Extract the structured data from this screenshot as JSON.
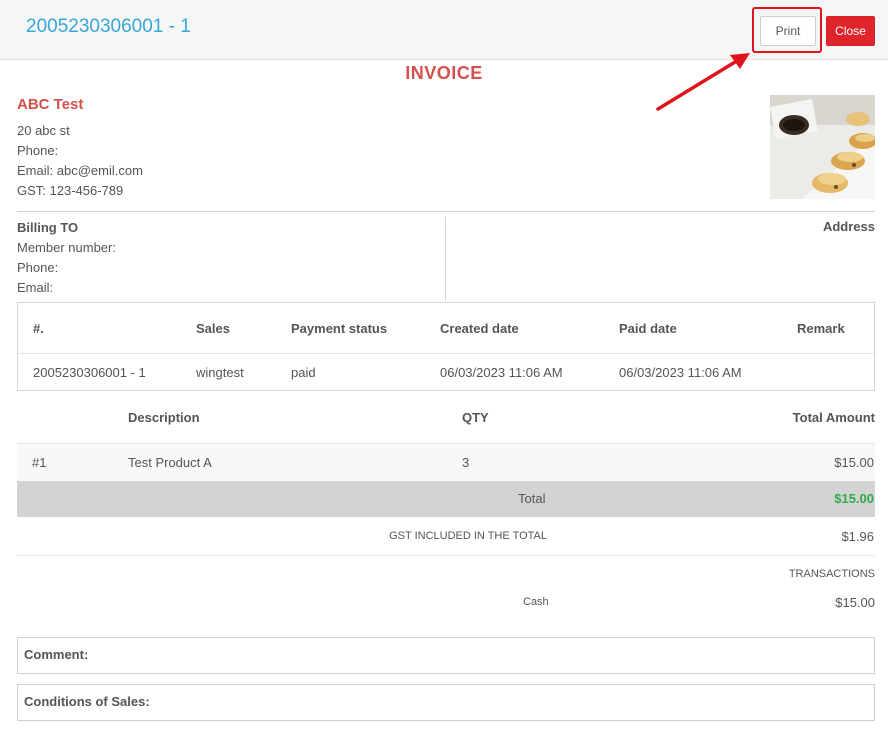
{
  "header": {
    "order_title": "2005230306001 - 1",
    "print_label": "Print",
    "close_label": "Close"
  },
  "invoice": {
    "title": "INVOICE",
    "company": {
      "name": "ABC Test",
      "address": "20 abc st",
      "phone": "Phone:",
      "email": "Email: abc@emil.com",
      "gst": "GST: 123-456-789"
    },
    "billing": {
      "heading": "Billing TO",
      "member_number": "Member number:",
      "phone": "Phone:",
      "email": "Email:",
      "address_heading": "Address"
    },
    "order_table": {
      "headers": [
        "#.",
        "Sales",
        "Payment status",
        "Created date",
        "Paid date",
        "Remark"
      ],
      "row": [
        "2005230306001 - 1",
        "wingtest",
        "paid",
        "06/03/2023 11:06 AM",
        "06/03/2023 11:06 AM",
        ""
      ]
    },
    "items_table": {
      "headers": [
        "Description",
        "QTY",
        "Total Amount"
      ],
      "rows": [
        {
          "index": "#1",
          "description": "Test Product A",
          "qty": "3",
          "amount": "$15.00"
        }
      ]
    },
    "totals": {
      "total_label": "Total",
      "total_value": "$15.00",
      "gst_label": "GST INCLUDED IN THE TOTAL",
      "gst_value": "$1.96",
      "transactions_label": "TRANSACTIONS",
      "cash_label": "Cash",
      "cash_value": "$15.00"
    },
    "comment_label": "Comment:",
    "conditions_label": "Conditions of Sales:"
  },
  "colors": {
    "title_blue": "#3aa6d6",
    "accent_red": "#d4504d",
    "close_red": "#e0242c",
    "total_green": "#2eaa4a",
    "annotation_red": "#e0151c"
  },
  "icons": {
    "annotation_arrow": "red-arrow-icon",
    "product_photo": "dumplings-photo"
  }
}
